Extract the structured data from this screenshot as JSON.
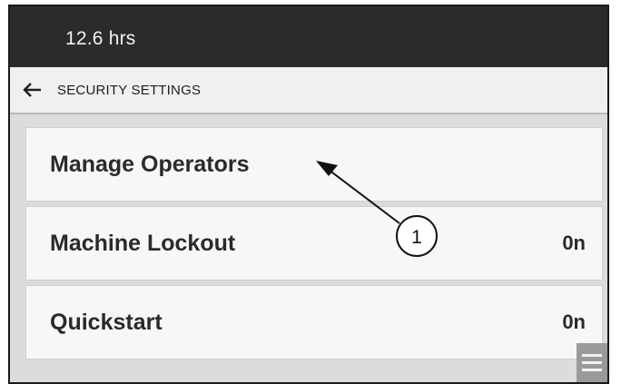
{
  "header": {
    "hours": "12.6 hrs"
  },
  "subbar": {
    "back_icon": "arrow-left-icon",
    "title": "SECURITY SETTINGS"
  },
  "rows": [
    {
      "label": "Manage Operators",
      "value": ""
    },
    {
      "label": "Machine Lockout",
      "value": "0n"
    },
    {
      "label": "Quickstart",
      "value": "0n"
    }
  ],
  "menu": {
    "icon": "hamburger-menu-icon"
  },
  "callout": {
    "number": "1"
  },
  "colors": {
    "header_bg": "#2b2b2b",
    "page_bg": "#dcdcdc",
    "row_bg": "#f7f7f7"
  }
}
